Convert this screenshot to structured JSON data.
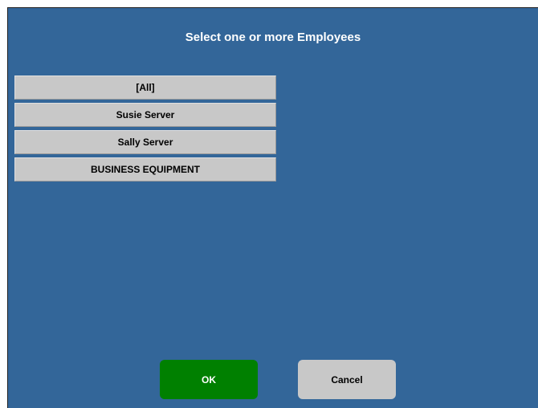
{
  "dialog": {
    "title": "Select one or more Employees"
  },
  "employees": [
    {
      "label": "[All]"
    },
    {
      "label": "Susie Server"
    },
    {
      "label": "Sally Server"
    },
    {
      "label": "BUSINESS EQUIPMENT"
    }
  ],
  "buttons": {
    "ok_label": "OK",
    "cancel_label": "Cancel"
  },
  "colors": {
    "background": "#336699",
    "list_item": "#c8c8c8",
    "ok_button": "#008000",
    "cancel_button": "#c8c8c8"
  }
}
